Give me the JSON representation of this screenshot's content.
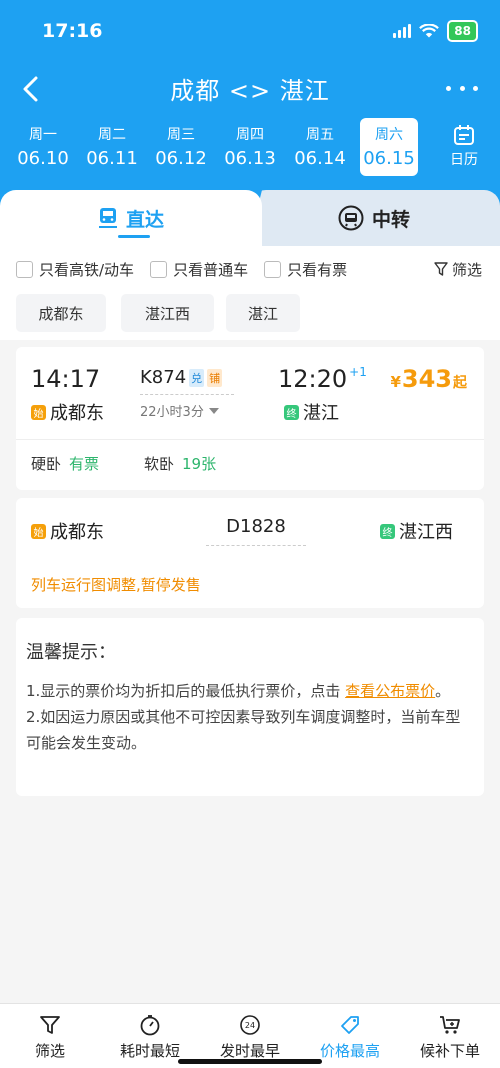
{
  "status_bar": {
    "time": "17:16",
    "battery": "88"
  },
  "nav": {
    "title": "成都 <> 湛江"
  },
  "dates": [
    {
      "weekday": "周一",
      "date": "06.10"
    },
    {
      "weekday": "周二",
      "date": "06.11"
    },
    {
      "weekday": "周三",
      "date": "06.12"
    },
    {
      "weekday": "周四",
      "date": "06.13"
    },
    {
      "weekday": "周五",
      "date": "06.14"
    },
    {
      "weekday": "周六",
      "date": "06.15"
    }
  ],
  "calendar_label": "日历",
  "tabs": {
    "direct": "直达",
    "transfer": "中转"
  },
  "filters": {
    "gaotie": "只看高铁/动车",
    "putong": "只看普通车",
    "youpiao": "只看有票",
    "shaixuan": "筛选"
  },
  "station_filters": [
    "成都东",
    "湛江西",
    "湛江"
  ],
  "trains": [
    {
      "depart_time": "14:17",
      "arrive_time": "12:20",
      "day_offset": "+1",
      "train_no": "K874",
      "tag1": "兑",
      "tag2": "铺",
      "duration": "22小时3分",
      "from": "成都东",
      "to": "湛江",
      "from_badge": "始",
      "to_badge": "终",
      "price_symbol": "¥",
      "price": "343",
      "price_suffix": "起",
      "seats": [
        {
          "type": "硬卧",
          "status": "有票"
        },
        {
          "type": "软卧",
          "status": "19张"
        }
      ]
    },
    {
      "train_no": "D1828",
      "from": "成都东",
      "to": "湛江西",
      "from_badge": "始",
      "to_badge": "终",
      "notice": "列车运行图调整,暂停发售"
    }
  ],
  "tips": {
    "title": "温馨提示：",
    "line1": "1.显示的票价均为折扣后的最低执行票价，点击",
    "link": "查看公布票价",
    "line1_end": "。",
    "line2": "2.如因运力原因或其他不可控因素导致列车调度调整时，当前车型可能会发生变动。"
  },
  "bottom_bar": [
    {
      "label": "筛选",
      "icon": "filter-icon"
    },
    {
      "label": "耗时最短",
      "icon": "timer-icon"
    },
    {
      "label": "发时最早",
      "icon": "clock-24-icon"
    },
    {
      "label": "价格最高",
      "icon": "price-tag-icon"
    },
    {
      "label": "候补下单",
      "icon": "cart-icon"
    }
  ],
  "colors": {
    "primary": "#1ea1f2",
    "price": "#f59b0c",
    "available": "#2db56c",
    "warning": "#f08c00"
  }
}
